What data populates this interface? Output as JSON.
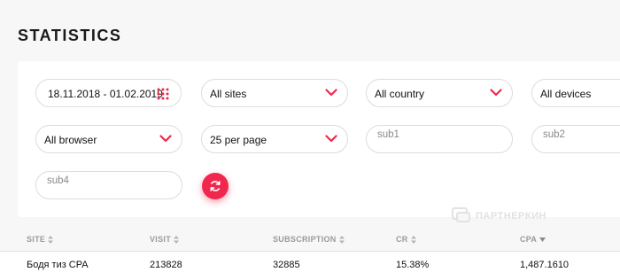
{
  "page": {
    "title": "STATISTICS"
  },
  "filters": {
    "date_range": "18.11.2018 - 01.02.2019",
    "site": "All sites",
    "country": "All country",
    "devices": "All devices",
    "browser": "All browser",
    "per_page": "25 per page",
    "sub1_placeholder": "sub1",
    "sub2_placeholder": "sub2",
    "sub4_placeholder": "sub4"
  },
  "icons": {
    "calendar": "calendar-dots-icon",
    "chevron": "chevron-down-icon",
    "refresh": "refresh-icon",
    "sort": "sort-icon"
  },
  "colors": {
    "accent": "#f1284d",
    "background": "#f7f7f7",
    "card": "#ffffff"
  },
  "watermark": {
    "text": "ПАРТНЕРКИН"
  },
  "table": {
    "columns": [
      "SITE",
      "VISIT",
      "SUBSCRIPTION",
      "CR",
      "CPA"
    ],
    "rows": [
      [
        "Бодя тиз CPA",
        "213828",
        "32885",
        "15.38%",
        "1,487.1610"
      ]
    ]
  }
}
